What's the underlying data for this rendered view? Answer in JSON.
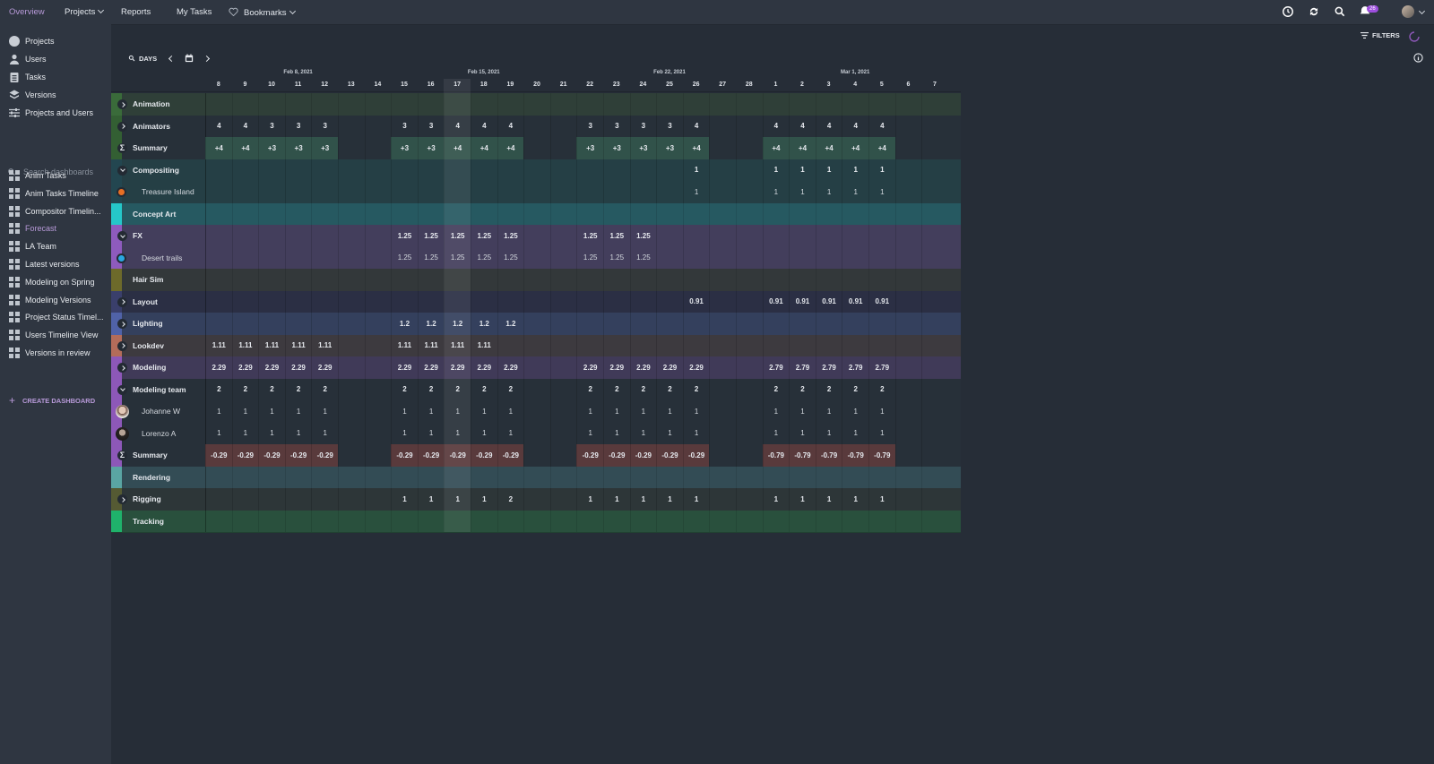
{
  "topnav": {
    "overview": "Overview",
    "projects": "Projects",
    "reports": "Reports",
    "my_tasks": "My Tasks",
    "bookmarks": "Bookmarks",
    "notification_count": "26"
  },
  "sidebar": {
    "main": [
      {
        "label": "Projects",
        "icon": "circle-icon"
      },
      {
        "label": "Users",
        "icon": "user-icon"
      },
      {
        "label": "Tasks",
        "icon": "clipboard-icon"
      },
      {
        "label": "Versions",
        "icon": "layers-icon"
      },
      {
        "label": "Projects and Users",
        "icon": "sliders-icon"
      }
    ],
    "search_placeholder": "Search dashboards",
    "dashboards": [
      "Anim Tasks",
      "Anim Tasks Timeline",
      "Compositor Timelin...",
      "Forecast",
      "LA Team",
      "Latest versions",
      "Modeling on Spring",
      "Modeling Versions",
      "Project Status Timel...",
      "Users Timeline View",
      "Versions in review"
    ],
    "active_dashboard": "Forecast",
    "create_label": "CREATE DASHBOARD"
  },
  "toolbar": {
    "filters_label": "FILTERS",
    "days_label": "DAYS"
  },
  "timeline": {
    "months": [
      "Feb 8, 2021",
      "Feb 15, 2021",
      "Feb 22, 2021",
      "Mar 1, 2021"
    ],
    "days": [
      "8",
      "9",
      "10",
      "11",
      "12",
      "13",
      "14",
      "15",
      "16",
      "17",
      "18",
      "19",
      "20",
      "21",
      "22",
      "23",
      "24",
      "25",
      "26",
      "27",
      "28",
      "1",
      "2",
      "3",
      "4",
      "5",
      "6",
      "7"
    ],
    "today_index": 9
  },
  "rows": [
    {
      "label": "Animation",
      "kind": "group",
      "toggle": "right",
      "strip": "#3a6b3a",
      "bg": "#2f3f38",
      "cells": []
    },
    {
      "label": "Animators",
      "kind": "group",
      "toggle": "right",
      "strip": "#335f33",
      "bg": "#273039",
      "cells": [
        "4",
        "4",
        "3",
        "3",
        "3",
        "",
        "",
        "3",
        "3",
        "4",
        "4",
        "4",
        "",
        "",
        "3",
        "3",
        "3",
        "3",
        "4",
        "",
        "",
        "4",
        "4",
        "4",
        "4",
        "4",
        "",
        ""
      ]
    },
    {
      "label": "Summary",
      "kind": "summary",
      "strip": "#335f33",
      "bg": "#273039",
      "pos_bg": "#31524a",
      "cells": [
        "+4",
        "+4",
        "+3",
        "+3",
        "+3",
        "",
        "",
        "+3",
        "+3",
        "+4",
        "+4",
        "+4",
        "",
        "",
        "+3",
        "+3",
        "+3",
        "+3",
        "+4",
        "",
        "",
        "+4",
        "+4",
        "+4",
        "+4",
        "+4",
        "",
        ""
      ]
    },
    {
      "label": "Compositing",
      "kind": "group",
      "toggle": "down",
      "strip": "#234650",
      "bg": "#253f45",
      "cells": [
        "",
        "",
        "",
        "",
        "",
        "",
        "",
        "",
        "",
        "",
        "",
        "",
        "",
        "",
        "",
        "",
        "",
        "",
        "1",
        "",
        "",
        "1",
        "1",
        "1",
        "1",
        "1",
        "",
        ""
      ]
    },
    {
      "label": "Treasure Island",
      "kind": "item",
      "dot": "#e76f24",
      "strip": "#234650",
      "bg": "#253f45",
      "cells": [
        "",
        "",
        "",
        "",
        "",
        "",
        "",
        "",
        "",
        "",
        "",
        "",
        "",
        "",
        "",
        "",
        "",
        "",
        "1",
        "",
        "",
        "1",
        "1",
        "1",
        "1",
        "1",
        "",
        ""
      ]
    },
    {
      "label": "Concept Art",
      "kind": "group",
      "strip": "#25c7c9",
      "bg": "#265961",
      "cells": []
    },
    {
      "label": "FX",
      "kind": "group",
      "toggle": "down",
      "strip": "#8e5bbd",
      "bg": "#433e5c",
      "cells": [
        "",
        "",
        "",
        "",
        "",
        "",
        "",
        "1.25",
        "1.25",
        "1.25",
        "1.25",
        "1.25",
        "",
        "",
        "1.25",
        "1.25",
        "1.25",
        "",
        "",
        "",
        "",
        "",
        "",
        "",
        "",
        "",
        "",
        ""
      ]
    },
    {
      "label": "Desert trails",
      "kind": "item",
      "dot": "#2aa7e0",
      "strip": "#8e5bbd",
      "bg": "#433e5c",
      "cells": [
        "",
        "",
        "",
        "",
        "",
        "",
        "",
        "1.25",
        "1.25",
        "1.25",
        "1.25",
        "1.25",
        "",
        "",
        "1.25",
        "1.25",
        "1.25",
        "",
        "",
        "",
        "",
        "",
        "",
        "",
        "",
        "",
        "",
        ""
      ]
    },
    {
      "label": "Hair Sim",
      "kind": "group",
      "strip": "#6d6a2a",
      "bg": "#33383a",
      "cells": []
    },
    {
      "label": "Layout",
      "kind": "group",
      "toggle": "right",
      "strip": "#3a3f6b",
      "bg": "#2b2f44",
      "cells": [
        "",
        "",
        "",
        "",
        "",
        "",
        "",
        "",
        "",
        "",
        "",
        "",
        "",
        "",
        "",
        "",
        "",
        "",
        "0.91",
        "",
        "",
        "0.91",
        "0.91",
        "0.91",
        "0.91",
        "0.91",
        "",
        ""
      ]
    },
    {
      "label": "Lighting",
      "kind": "group",
      "toggle": "right",
      "strip": "#5062a8",
      "bg": "#34405d",
      "cells": [
        "",
        "",
        "",
        "",
        "",
        "",
        "",
        "1.2",
        "1.2",
        "1.2",
        "1.2",
        "1.2",
        "",
        "",
        "",
        "",
        "",
        "",
        "",
        "",
        "",
        "",
        "",
        "",
        "",
        "",
        "",
        ""
      ]
    },
    {
      "label": "Lookdev",
      "kind": "group",
      "toggle": "right",
      "strip": "#b36c5a",
      "bg": "#3d3a3f",
      "cells": [
        "1.11",
        "1.11",
        "1.11",
        "1.11",
        "1.11",
        "",
        "",
        "1.11",
        "1.11",
        "1.11",
        "1.11",
        "",
        "",
        "",
        "",
        "",
        "",
        "",
        "",
        "",
        "",
        "",
        "",
        "",
        "",
        "",
        "",
        ""
      ]
    },
    {
      "label": "Modeling",
      "kind": "group",
      "toggle": "right",
      "strip": "#8d58b8",
      "bg": "#403a58",
      "cells": [
        "2.29",
        "2.29",
        "2.29",
        "2.29",
        "2.29",
        "",
        "",
        "2.29",
        "2.29",
        "2.29",
        "2.29",
        "2.29",
        "",
        "",
        "2.29",
        "2.29",
        "2.29",
        "2.29",
        "2.29",
        "",
        "",
        "2.79",
        "2.79",
        "2.79",
        "2.79",
        "2.79",
        "",
        ""
      ]
    },
    {
      "label": "Modeling team",
      "kind": "group",
      "toggle": "down",
      "strip": "#8d58b8",
      "bg": "#273039",
      "cells": [
        "2",
        "2",
        "2",
        "2",
        "2",
        "",
        "",
        "2",
        "2",
        "2",
        "2",
        "2",
        "",
        "",
        "2",
        "2",
        "2",
        "2",
        "2",
        "",
        "",
        "2",
        "2",
        "2",
        "2",
        "2",
        "",
        ""
      ]
    },
    {
      "label": "Johanne W",
      "kind": "user",
      "avatar": "f",
      "strip": "#8d58b8",
      "bg": "#273039",
      "cells": [
        "1",
        "1",
        "1",
        "1",
        "1",
        "",
        "",
        "1",
        "1",
        "1",
        "1",
        "1",
        "",
        "",
        "1",
        "1",
        "1",
        "1",
        "1",
        "",
        "",
        "1",
        "1",
        "1",
        "1",
        "1",
        "",
        ""
      ]
    },
    {
      "label": "Lorenzo A",
      "kind": "user",
      "avatar": "m",
      "strip": "#8d58b8",
      "bg": "#273039",
      "cells": [
        "1",
        "1",
        "1",
        "1",
        "1",
        "",
        "",
        "1",
        "1",
        "1",
        "1",
        "1",
        "",
        "",
        "1",
        "1",
        "1",
        "1",
        "1",
        "",
        "",
        "1",
        "1",
        "1",
        "1",
        "1",
        "",
        ""
      ]
    },
    {
      "label": "Summary",
      "kind": "summary",
      "strip": "#8d58b8",
      "bg": "#273039",
      "neg_bg": "#593a3c",
      "cells": [
        "-0.29",
        "-0.29",
        "-0.29",
        "-0.29",
        "-0.29",
        "",
        "",
        "-0.29",
        "-0.29",
        "-0.29",
        "-0.29",
        "-0.29",
        "",
        "",
        "-0.29",
        "-0.29",
        "-0.29",
        "-0.29",
        "-0.29",
        "",
        "",
        "-0.79",
        "-0.79",
        "-0.79",
        "-0.79",
        "-0.79",
        "",
        ""
      ]
    },
    {
      "label": "Rendering",
      "kind": "group",
      "strip": "#5aa5a3",
      "bg": "#334c55",
      "cells": []
    },
    {
      "label": "Rigging",
      "kind": "group",
      "toggle": "right",
      "strip": "#555a33",
      "bg": "#2d3638",
      "cells": [
        "",
        "",
        "",
        "",
        "",
        "",
        "",
        "1",
        "1",
        "1",
        "1",
        "2",
        "",
        "",
        "1",
        "1",
        "1",
        "1",
        "1",
        "",
        "",
        "1",
        "1",
        "1",
        "1",
        "1",
        "",
        ""
      ]
    },
    {
      "label": "Tracking",
      "kind": "group",
      "strip": "#1fb26b",
      "bg": "#29503d",
      "cells": []
    }
  ]
}
